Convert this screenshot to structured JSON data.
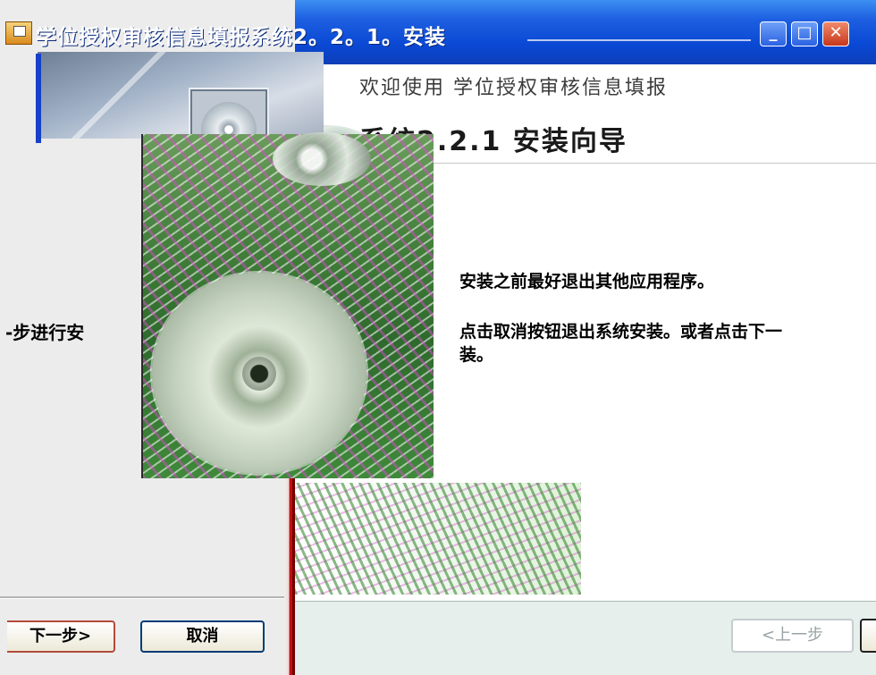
{
  "window": {
    "title": "学位授权审核信息填报系统2.2.1 安装",
    "title_display": "学位授权审核信息填报系统2。2。1。安装"
  },
  "wizard": {
    "header_line1": "欢迎使用 学位授权审核信息填报",
    "header_line2": "系统2.2.1 安装向导",
    "body_line1": "安装之前最好退出其他应用程序。",
    "body_line2": "点击取消按钮退出系统安装。或者点击下一",
    "body_line3": "装。",
    "side_text_fragment": "-步进行安"
  },
  "buttons": {
    "next_label": "下一步>",
    "cancel_label": "取消",
    "prev_label": "<上一步",
    "minimize_label": "_",
    "maximize_label": "□",
    "close_label": "✕"
  },
  "colors": {
    "titlebar": "#0a48d4",
    "button_border": "#003c74",
    "footer_back": "#e7efec",
    "accent_red": "#c01010"
  }
}
